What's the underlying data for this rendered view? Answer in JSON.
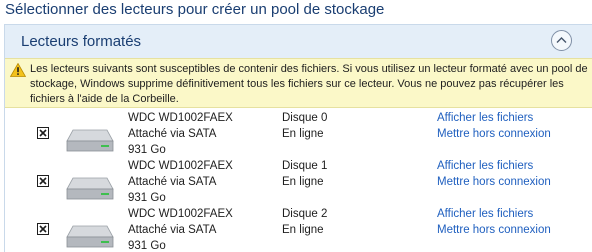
{
  "page": {
    "title": "Sélectionner des lecteurs pour créer un pool de stockage"
  },
  "panel": {
    "title": "Lecteurs formatés",
    "collapse_icon": "chevron-up-icon"
  },
  "warning": {
    "icon": "warning-icon",
    "text": "Les lecteurs suivants sont susceptibles de contenir des fichiers. Si vous utilisez un lecteur formaté avec un pool de stockage, Windows supprime définitivement tous les fichiers sur ce lecteur. Vous ne pouvez pas récupérer les fichiers à l'aide de la Corbeille."
  },
  "drives": [
    {
      "checked": true,
      "model": "WDC WD1002FAEX",
      "connection": "Attaché via SATA",
      "capacity": "931 Go",
      "disk": "Disque 0",
      "status": "En ligne",
      "show_files": "Afficher les fichiers",
      "take_offline": "Mettre hors connexion"
    },
    {
      "checked": true,
      "model": "WDC WD1002FAEX",
      "connection": "Attaché via SATA",
      "capacity": "931 Go",
      "disk": "Disque 1",
      "status": "En ligne",
      "show_files": "Afficher les fichiers",
      "take_offline": "Mettre hors connexion"
    },
    {
      "checked": true,
      "model": "WDC WD1002FAEX",
      "connection": "Attaché via SATA",
      "capacity": "931 Go",
      "disk": "Disque 2",
      "status": "En ligne",
      "show_files": "Afficher les fichiers",
      "take_offline": "Mettre hors connexion"
    }
  ],
  "colors": {
    "title": "#1a3e72",
    "header_bg": "#e4eef8",
    "warning_bg": "#fbf8c8",
    "link": "#1f5fbf"
  }
}
